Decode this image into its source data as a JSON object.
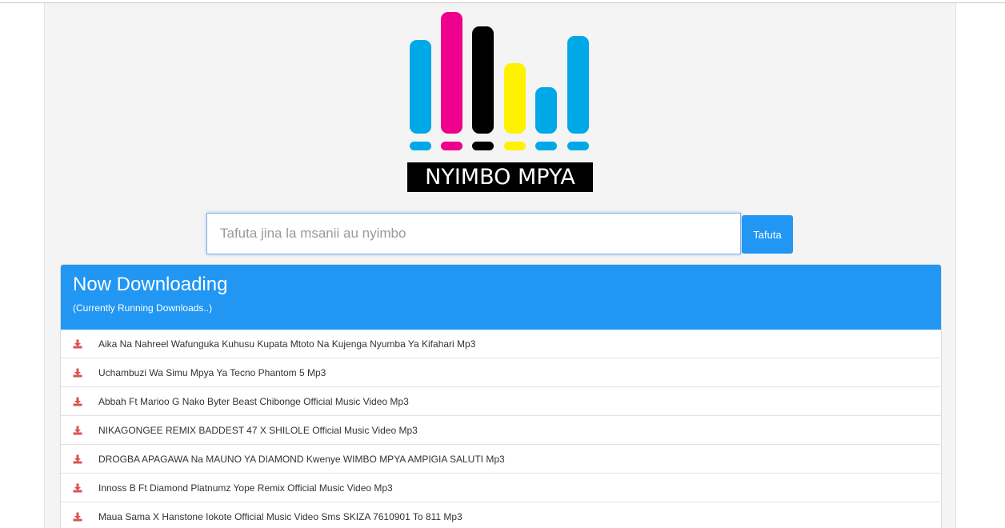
{
  "logo": {
    "text": "NYIMBO MPYA",
    "bars": [
      {
        "color": "#00a8e8",
        "level": 0.77
      },
      {
        "color": "#ec008c",
        "level": 1.0
      },
      {
        "color": "#000000",
        "level": 0.88
      },
      {
        "color": "#fff200",
        "level": 0.58
      },
      {
        "color": "#00a8e8",
        "level": 0.38
      },
      {
        "color": "#00a8e8",
        "level": 0.8
      }
    ]
  },
  "search": {
    "placeholder": "Tafuta jina la msanii au nyimbo",
    "button_label": "Tafuta"
  },
  "panel": {
    "title": "Now Downloading",
    "subtitle": "(Currently Running Downloads..)",
    "icon": "download-icon",
    "icon_color": "#d9534f",
    "items": [
      "Aika Na Nahreel Wafunguka Kuhusu Kupata Mtoto Na Kujenga Nyumba Ya Kifahari Mp3",
      "Uchambuzi Wa Simu Mpya Ya Tecno Phantom 5 Mp3",
      "Abbah Ft Marioo G Nako Byter Beast Chibonge Official Music Video Mp3",
      "NIKAGONGEE REMIX BADDEST 47 X SHILOLE Official Music Video Mp3",
      "DROGBA APAGAWA Na MAUNO YA DIAMOND Kwenye WIMBO MPYA AMPIGIA SALUTI Mp3",
      "Innoss B Ft Diamond Platnumz Yope Remix Official Music Video Mp3",
      "Maua Sama X Hanstone Iokote Official Music Video Sms SKIZA 7610901 To 811 Mp3"
    ]
  },
  "colors": {
    "accent": "#2196f3",
    "background": "#f4f4f4"
  }
}
